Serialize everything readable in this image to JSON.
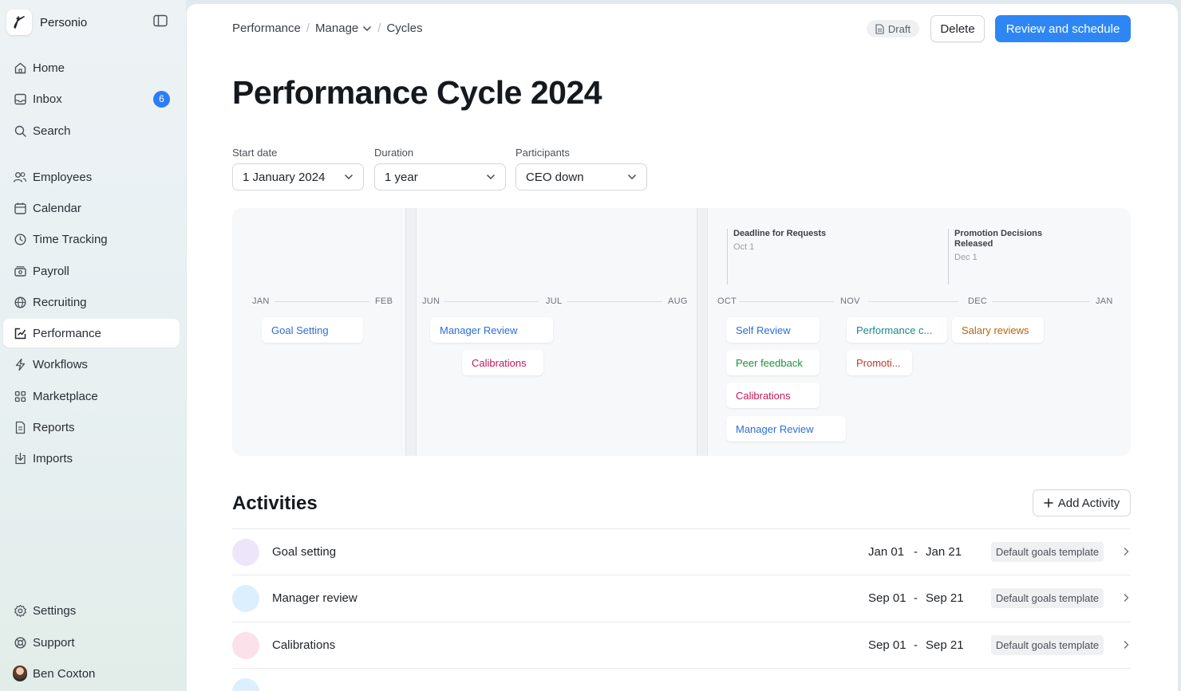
{
  "brand": {
    "name": "Personio"
  },
  "sidebar": {
    "items": [
      {
        "label": "Home",
        "icon": "home-icon"
      },
      {
        "label": "Inbox",
        "icon": "inbox-icon",
        "badge": "6"
      },
      {
        "label": "Search",
        "icon": "search-icon"
      },
      {
        "label": "Employees",
        "icon": "employees-icon"
      },
      {
        "label": "Calendar",
        "icon": "calendar-icon"
      },
      {
        "label": "Time Tracking",
        "icon": "clock-icon"
      },
      {
        "label": "Payroll",
        "icon": "payroll-icon"
      },
      {
        "label": "Recruiting",
        "icon": "globe-icon"
      },
      {
        "label": "Performance",
        "icon": "performance-icon",
        "active": true
      },
      {
        "label": "Workflows",
        "icon": "lightning-icon"
      },
      {
        "label": "Marketplace",
        "icon": "grid-icon"
      },
      {
        "label": "Reports",
        "icon": "reports-icon"
      },
      {
        "label": "Imports",
        "icon": "import-icon"
      }
    ],
    "bottom": [
      {
        "label": "Settings",
        "icon": "gear-icon"
      },
      {
        "label": "Support",
        "icon": "lifebuoy-icon"
      },
      {
        "label": "Ben Coxton",
        "icon": "avatar"
      }
    ]
  },
  "header": {
    "breadcrumb": [
      "Performance",
      "Manage",
      "Cycles"
    ],
    "status": "Draft",
    "delete_label": "Delete",
    "primary_label": "Review and schedule"
  },
  "page": {
    "title": "Performance Cycle 2024"
  },
  "filters": {
    "start_date": {
      "label": "Start date",
      "value": "1 January 2024"
    },
    "duration": {
      "label": "Duration",
      "value": "1 year"
    },
    "participants": {
      "label": "Participants",
      "value": "CEO down"
    }
  },
  "timeline": {
    "months": [
      "JAN",
      "FEB",
      "JUN",
      "JUL",
      "AUG",
      "OCT",
      "NOV",
      "DEC",
      "JAN"
    ],
    "milestones": [
      {
        "title": "Deadline for Requests",
        "date": "Oct 1"
      },
      {
        "title": "Promotion Decisions Released",
        "date": "Dec 1"
      }
    ],
    "chips": [
      {
        "label": "Goal Setting",
        "color": "#2b6fd6"
      },
      {
        "label": "Manager Review",
        "color": "#2b6fd6"
      },
      {
        "label": "Calibrations",
        "color": "#c2185b"
      },
      {
        "label": "Self Review",
        "color": "#2b6fd6"
      },
      {
        "label": "Peer feedback",
        "color": "#1e8e3e"
      },
      {
        "label": "Calibrations",
        "color": "#c2185b"
      },
      {
        "label": "Manager Review",
        "color": "#2b6fd6"
      },
      {
        "label": "Performance c...",
        "color": "#1a8a8a"
      },
      {
        "label": "Promoti...",
        "color": "#c0392b"
      },
      {
        "label": "Salary reviews",
        "color": "#b8650f"
      }
    ]
  },
  "activities": {
    "title": "Activities",
    "add_label": "Add Activity",
    "rows": [
      {
        "name": "Goal setting",
        "start": "Jan 01",
        "end": "Jan 21",
        "tag": "Default goals template",
        "dot": "#ede6fb"
      },
      {
        "name": "Manager review",
        "start": "Sep 01",
        "end": "Sep 21",
        "tag": "Default goals template",
        "dot": "#dcefff"
      },
      {
        "name": "Calibrations",
        "start": "Sep 01",
        "end": "Sep 21",
        "tag": "Default goals template",
        "dot": "#fbe1ea"
      }
    ]
  }
}
